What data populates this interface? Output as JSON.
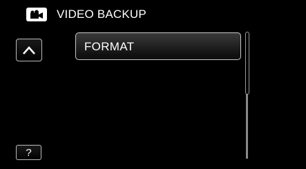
{
  "header": {
    "title": "VIDEO BACKUP",
    "icon": "video-camera-icon"
  },
  "navigation": {
    "up_icon": "chevron-up-icon",
    "help_label": "?"
  },
  "menu": {
    "items": [
      {
        "label": "FORMAT"
      }
    ]
  },
  "scrollbar": {
    "position_fraction": 0.0
  },
  "colors": {
    "background": "#000000",
    "text": "#ffffff",
    "border": "#c8c8c8"
  }
}
